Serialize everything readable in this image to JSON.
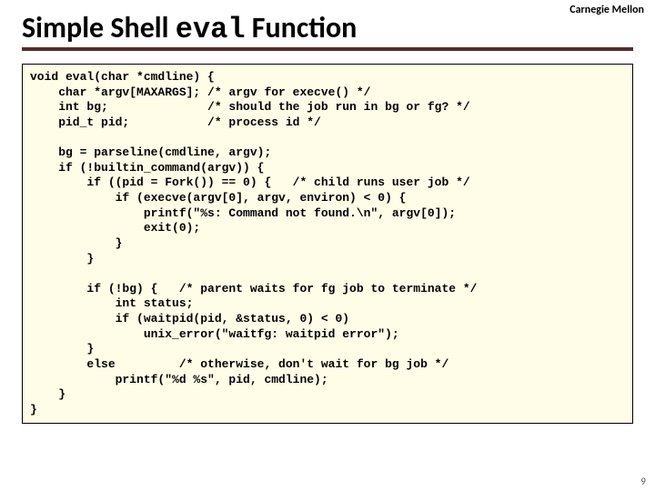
{
  "university": "Carnegie Mellon",
  "title_prefix": "Simple Shell ",
  "title_code": "eval",
  "title_suffix": " Function",
  "code": "void eval(char *cmdline) {\n    char *argv[MAXARGS]; /* argv for execve() */\n    int bg;              /* should the job run in bg or fg? */\n    pid_t pid;           /* process id */\n\n    bg = parseline(cmdline, argv);\n    if (!builtin_command(argv)) {\n        if ((pid = Fork()) == 0) {   /* child runs user job */\n            if (execve(argv[0], argv, environ) < 0) {\n                printf(\"%s: Command not found.\\n\", argv[0]);\n                exit(0);\n            }\n        }\n\n        if (!bg) {   /* parent waits for fg job to terminate */\n            int status;\n            if (waitpid(pid, &status, 0) < 0)\n                unix_error(\"waitfg: waitpid error\");\n        }\n        else         /* otherwise, don't wait for bg job */\n            printf(\"%d %s\", pid, cmdline);\n    }\n}",
  "page_number": "9"
}
